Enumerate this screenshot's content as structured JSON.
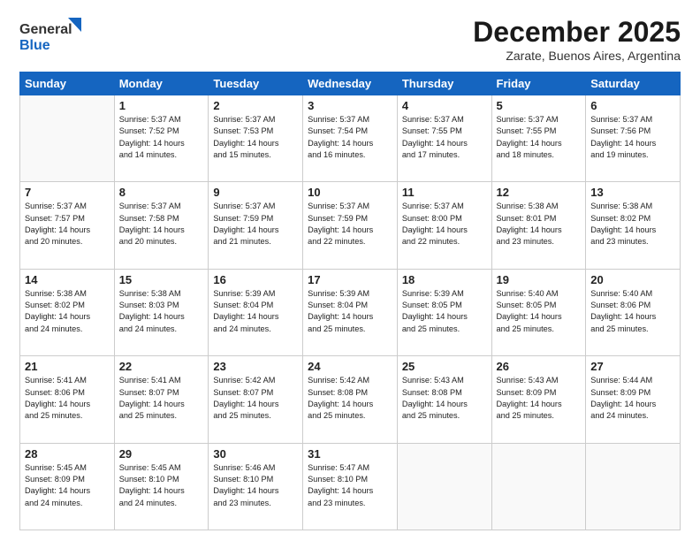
{
  "header": {
    "logo_line1": "General",
    "logo_line2": "Blue",
    "month": "December 2025",
    "location": "Zarate, Buenos Aires, Argentina"
  },
  "days_of_week": [
    "Sunday",
    "Monday",
    "Tuesday",
    "Wednesday",
    "Thursday",
    "Friday",
    "Saturday"
  ],
  "weeks": [
    [
      {
        "day": "",
        "info": ""
      },
      {
        "day": "1",
        "info": "Sunrise: 5:37 AM\nSunset: 7:52 PM\nDaylight: 14 hours\nand 14 minutes."
      },
      {
        "day": "2",
        "info": "Sunrise: 5:37 AM\nSunset: 7:53 PM\nDaylight: 14 hours\nand 15 minutes."
      },
      {
        "day": "3",
        "info": "Sunrise: 5:37 AM\nSunset: 7:54 PM\nDaylight: 14 hours\nand 16 minutes."
      },
      {
        "day": "4",
        "info": "Sunrise: 5:37 AM\nSunset: 7:55 PM\nDaylight: 14 hours\nand 17 minutes."
      },
      {
        "day": "5",
        "info": "Sunrise: 5:37 AM\nSunset: 7:55 PM\nDaylight: 14 hours\nand 18 minutes."
      },
      {
        "day": "6",
        "info": "Sunrise: 5:37 AM\nSunset: 7:56 PM\nDaylight: 14 hours\nand 19 minutes."
      }
    ],
    [
      {
        "day": "7",
        "info": "Sunrise: 5:37 AM\nSunset: 7:57 PM\nDaylight: 14 hours\nand 20 minutes."
      },
      {
        "day": "8",
        "info": "Sunrise: 5:37 AM\nSunset: 7:58 PM\nDaylight: 14 hours\nand 20 minutes."
      },
      {
        "day": "9",
        "info": "Sunrise: 5:37 AM\nSunset: 7:59 PM\nDaylight: 14 hours\nand 21 minutes."
      },
      {
        "day": "10",
        "info": "Sunrise: 5:37 AM\nSunset: 7:59 PM\nDaylight: 14 hours\nand 22 minutes."
      },
      {
        "day": "11",
        "info": "Sunrise: 5:37 AM\nSunset: 8:00 PM\nDaylight: 14 hours\nand 22 minutes."
      },
      {
        "day": "12",
        "info": "Sunrise: 5:38 AM\nSunset: 8:01 PM\nDaylight: 14 hours\nand 23 minutes."
      },
      {
        "day": "13",
        "info": "Sunrise: 5:38 AM\nSunset: 8:02 PM\nDaylight: 14 hours\nand 23 minutes."
      }
    ],
    [
      {
        "day": "14",
        "info": "Sunrise: 5:38 AM\nSunset: 8:02 PM\nDaylight: 14 hours\nand 24 minutes."
      },
      {
        "day": "15",
        "info": "Sunrise: 5:38 AM\nSunset: 8:03 PM\nDaylight: 14 hours\nand 24 minutes."
      },
      {
        "day": "16",
        "info": "Sunrise: 5:39 AM\nSunset: 8:04 PM\nDaylight: 14 hours\nand 24 minutes."
      },
      {
        "day": "17",
        "info": "Sunrise: 5:39 AM\nSunset: 8:04 PM\nDaylight: 14 hours\nand 25 minutes."
      },
      {
        "day": "18",
        "info": "Sunrise: 5:39 AM\nSunset: 8:05 PM\nDaylight: 14 hours\nand 25 minutes."
      },
      {
        "day": "19",
        "info": "Sunrise: 5:40 AM\nSunset: 8:05 PM\nDaylight: 14 hours\nand 25 minutes."
      },
      {
        "day": "20",
        "info": "Sunrise: 5:40 AM\nSunset: 8:06 PM\nDaylight: 14 hours\nand 25 minutes."
      }
    ],
    [
      {
        "day": "21",
        "info": "Sunrise: 5:41 AM\nSunset: 8:06 PM\nDaylight: 14 hours\nand 25 minutes."
      },
      {
        "day": "22",
        "info": "Sunrise: 5:41 AM\nSunset: 8:07 PM\nDaylight: 14 hours\nand 25 minutes."
      },
      {
        "day": "23",
        "info": "Sunrise: 5:42 AM\nSunset: 8:07 PM\nDaylight: 14 hours\nand 25 minutes."
      },
      {
        "day": "24",
        "info": "Sunrise: 5:42 AM\nSunset: 8:08 PM\nDaylight: 14 hours\nand 25 minutes."
      },
      {
        "day": "25",
        "info": "Sunrise: 5:43 AM\nSunset: 8:08 PM\nDaylight: 14 hours\nand 25 minutes."
      },
      {
        "day": "26",
        "info": "Sunrise: 5:43 AM\nSunset: 8:09 PM\nDaylight: 14 hours\nand 25 minutes."
      },
      {
        "day": "27",
        "info": "Sunrise: 5:44 AM\nSunset: 8:09 PM\nDaylight: 14 hours\nand 24 minutes."
      }
    ],
    [
      {
        "day": "28",
        "info": "Sunrise: 5:45 AM\nSunset: 8:09 PM\nDaylight: 14 hours\nand 24 minutes."
      },
      {
        "day": "29",
        "info": "Sunrise: 5:45 AM\nSunset: 8:10 PM\nDaylight: 14 hours\nand 24 minutes."
      },
      {
        "day": "30",
        "info": "Sunrise: 5:46 AM\nSunset: 8:10 PM\nDaylight: 14 hours\nand 23 minutes."
      },
      {
        "day": "31",
        "info": "Sunrise: 5:47 AM\nSunset: 8:10 PM\nDaylight: 14 hours\nand 23 minutes."
      },
      {
        "day": "",
        "info": ""
      },
      {
        "day": "",
        "info": ""
      },
      {
        "day": "",
        "info": ""
      }
    ]
  ]
}
